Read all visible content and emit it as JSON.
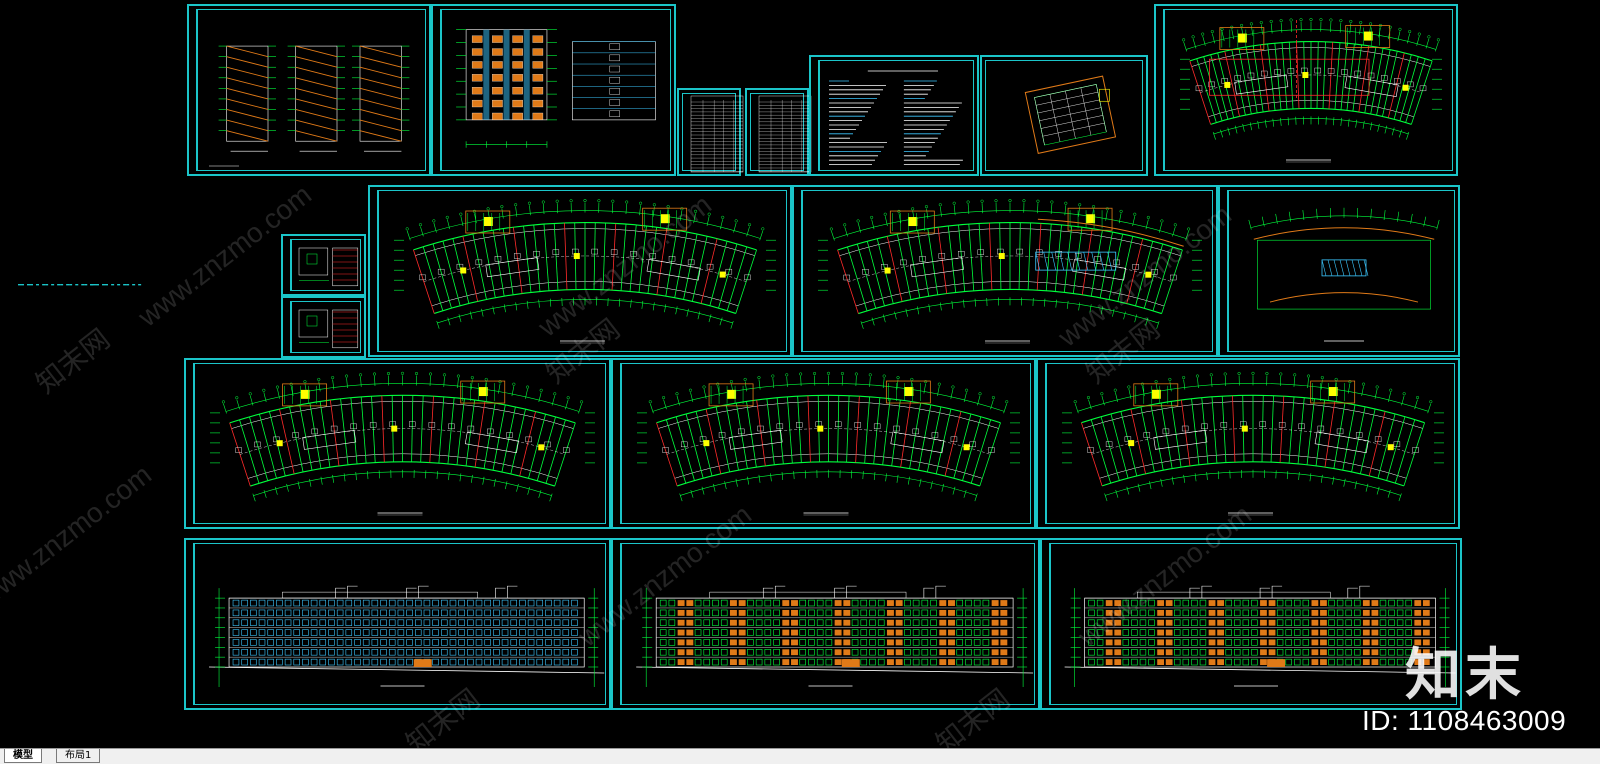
{
  "tabs": [
    {
      "label": "模型",
      "active": true
    },
    {
      "label": "布局1",
      "active": false
    }
  ],
  "watermark": {
    "logo": "知末",
    "id_text": "ID: 1108463009",
    "site": "www.znzmo.com",
    "cn": "知末网"
  },
  "colors": {
    "frame": "#1bc5c9",
    "wall": "#00ff3c",
    "red": "#ff2a2a",
    "yellow": "#ffff00",
    "orange": "#e07a18",
    "blue": "#3cc8ff",
    "white": "#ffffff"
  },
  "icons": {
    "tab_separator": "slash-tab-shape"
  }
}
